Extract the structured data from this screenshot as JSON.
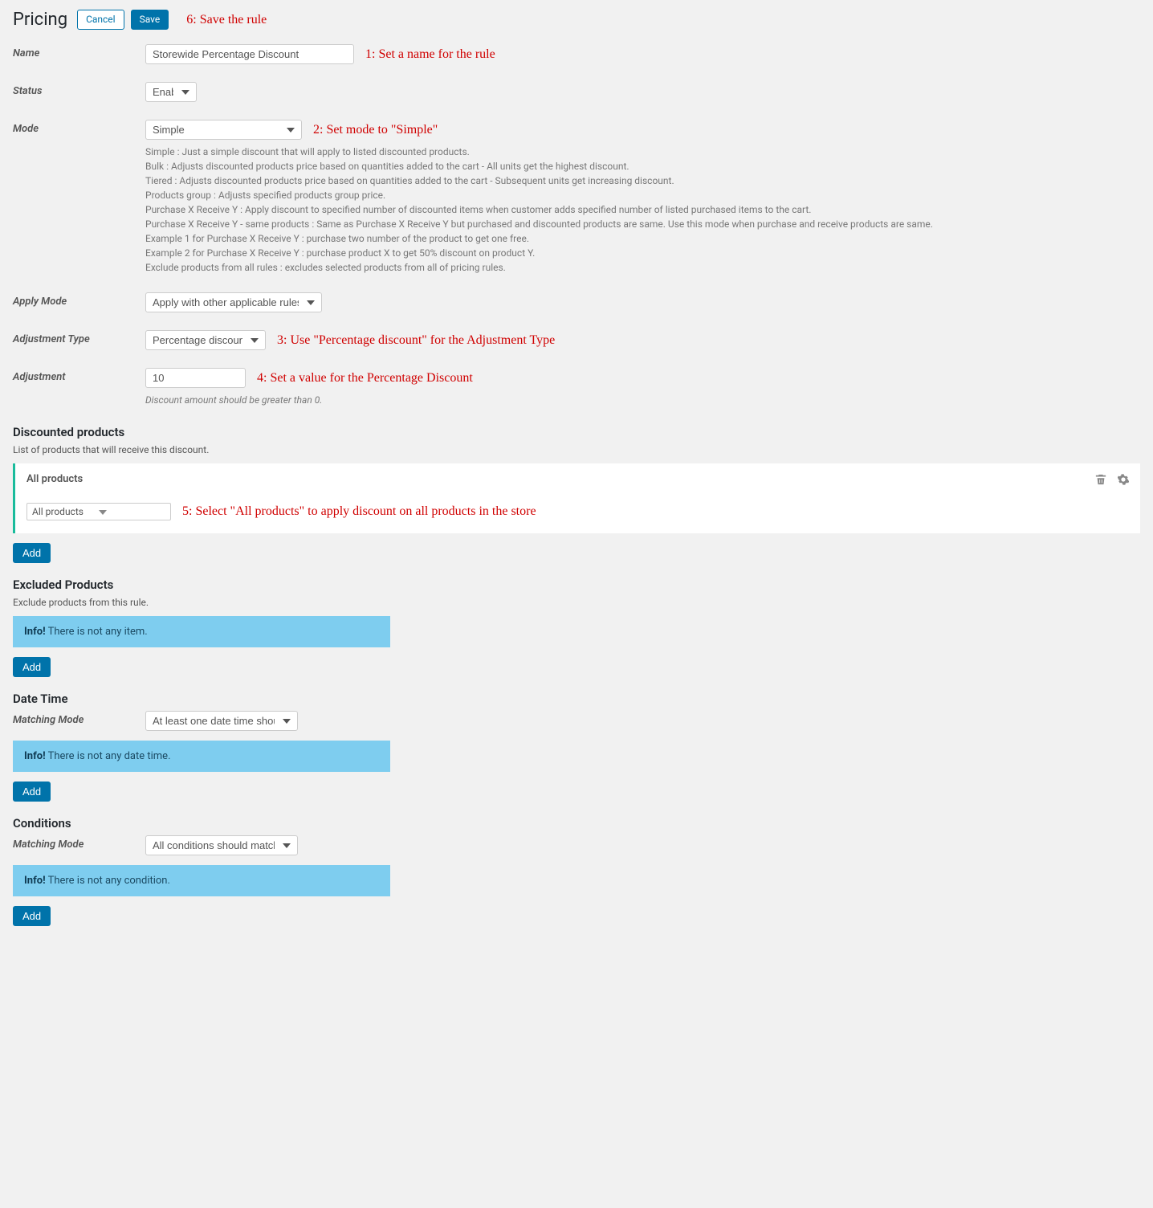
{
  "header": {
    "title": "Pricing",
    "cancel_label": "Cancel",
    "save_label": "Save"
  },
  "annotations": {
    "a6": "6: Save the rule",
    "a1": "1: Set a name for the rule",
    "a2": "2: Set mode to \"Simple\"",
    "a3": "3: Use \"Percentage discount\" for the Adjustment Type",
    "a4": "4: Set a value for the Percentage Discount",
    "a5": "5: Select \"All products\" to apply discount on all products in the store"
  },
  "labels": {
    "name": "Name",
    "status": "Status",
    "mode": "Mode",
    "apply_mode": "Apply Mode",
    "adjustment_type": "Adjustment Type",
    "adjustment": "Adjustment",
    "matching_mode": "Matching Mode"
  },
  "values": {
    "name": "Storewide Percentage Discount",
    "status": "Enabled",
    "mode": "Simple",
    "apply_mode": "Apply with other applicable rules",
    "adjustment_type": "Percentage discount",
    "adjustment": "10",
    "adjustment_help": "Discount amount should be greater than 0.",
    "date_matching": "At least one date time should match",
    "cond_matching": "All conditions should match"
  },
  "mode_help": {
    "l1": "Simple : Just a simple discount that will apply to listed discounted products.",
    "l2": "Bulk : Adjusts discounted products price based on quantities added to the cart - All units get the highest discount.",
    "l3": "Tiered : Adjusts discounted products price based on quantities added to the cart - Subsequent units get increasing discount.",
    "l4": "Products group : Adjusts specified products group price.",
    "l5": "Purchase X Receive Y : Apply discount to specified number of discounted items when customer adds specified number of listed purchased items to the cart.",
    "l6": "Purchase X Receive Y - same products : Same as Purchase X Receive Y but purchased and discounted products are same. Use this mode when purchase and receive products are same.",
    "l7": "Example 1 for Purchase X Receive Y : purchase two number of the product to get one free.",
    "l8": "Example 2 for Purchase X Receive Y : purchase product X to get 50% discount on product Y.",
    "l9": "Exclude products from all rules : excludes selected products from all of pricing rules."
  },
  "discounted": {
    "heading": "Discounted products",
    "sub": "List of products that will receive this discount.",
    "panel_title": "All products",
    "combo_value": "All products",
    "add_label": "Add"
  },
  "excluded": {
    "heading": "Excluded Products",
    "sub": "Exclude products from this rule.",
    "info_bold": "Info!",
    "info_text": " There is not any item.",
    "add_label": "Add"
  },
  "datetime": {
    "heading": "Date Time",
    "info_bold": "Info!",
    "info_text": " There is not any date time.",
    "add_label": "Add"
  },
  "conditions": {
    "heading": "Conditions",
    "info_bold": "Info!",
    "info_text": " There is not any condition.",
    "add_label": "Add"
  }
}
